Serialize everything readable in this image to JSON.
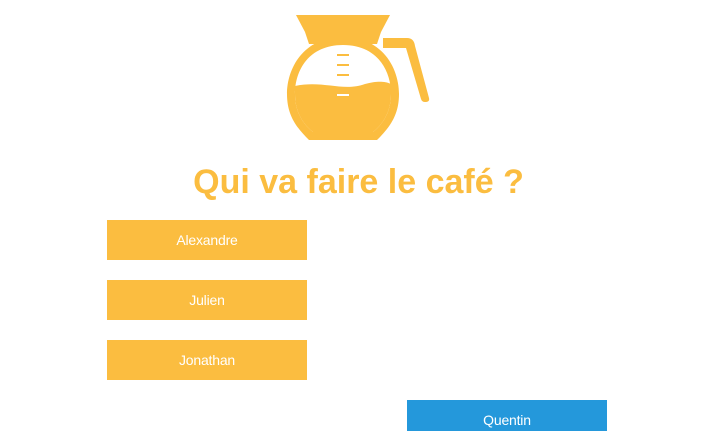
{
  "colors": {
    "accent": "#fbbd40",
    "selected": "#2498db",
    "button_text": "#ffffff"
  },
  "header": {
    "icon": "coffee-pot-icon",
    "title": "Qui va faire le café ?"
  },
  "people": [
    {
      "name": "Alexandre",
      "state": "pending"
    },
    {
      "name": "Julien",
      "state": "pending"
    },
    {
      "name": "Jonathan",
      "state": "pending"
    },
    {
      "name": "Quentin",
      "state": "selected"
    }
  ]
}
